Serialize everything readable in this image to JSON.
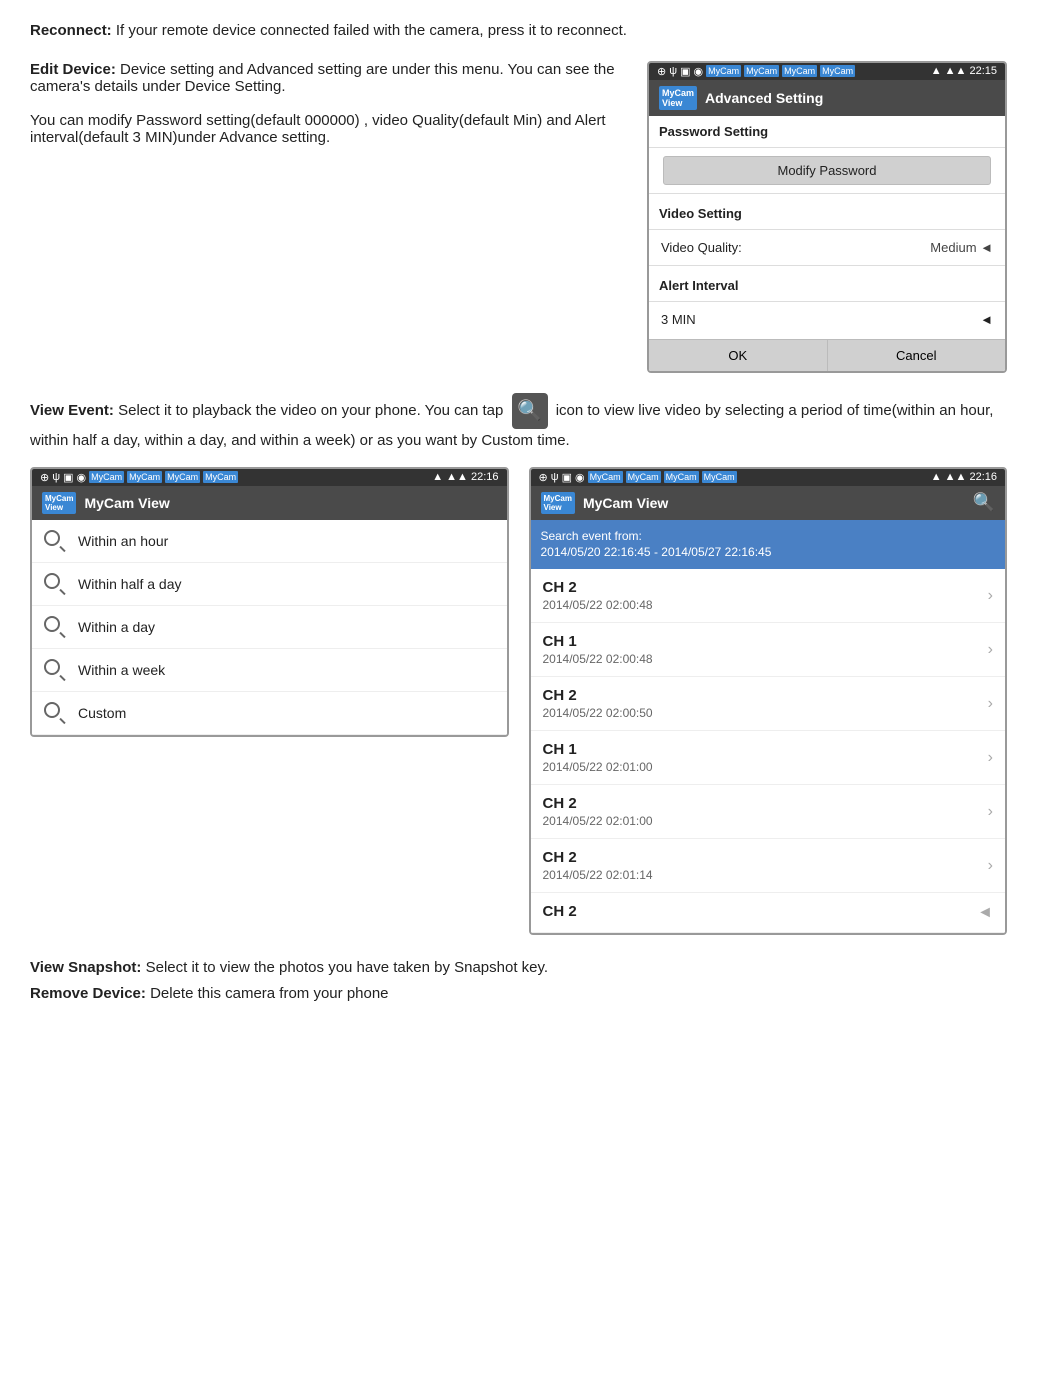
{
  "reconnect": {
    "label": "Reconnect:",
    "text": "If your remote device connected failed with the camera, press it to reconnect."
  },
  "editDevice": {
    "label": "Edit Device:",
    "para1": "Device setting and Advanced setting are under this menu. You can see the camera's details under Device Setting.",
    "para2": "You can modify Password setting(default 000000) , video Quality(default Min) and Alert interval(default 3 MIN)under Advance setting.",
    "phone": {
      "statusbar": {
        "left_icons": "⊕ ψ ▣ ◉",
        "app_icons": "MyCam MyCam MyCam MyCam",
        "right": "▲ ▲▲ 22:15"
      },
      "title": "Advanced Setting",
      "sections": [
        {
          "name": "Password Setting",
          "button": "Modify Password"
        },
        {
          "name": "Video Setting",
          "row_label": "Video Quality:",
          "row_value": "Medium"
        },
        {
          "name": "Alert Interval",
          "row_label": "3 MIN"
        }
      ],
      "ok_label": "OK",
      "cancel_label": "Cancel"
    }
  },
  "viewEvent": {
    "label": "View Event:",
    "text": "Select it to playback the video on your phone. You can tap",
    "text2": "icon to view live video by selecting a period of time(within an hour, within half a day, within a day, and within a week) or as you want by Custom time.",
    "left_phone": {
      "statusbar_right": "22:16",
      "title": "MyCam View",
      "logo": "MyCam View",
      "menu_items": [
        "Within an hour",
        "Within half a day",
        "Within a day",
        "Within a week",
        "Custom"
      ]
    },
    "right_phone": {
      "statusbar_right": "22:16",
      "title": "MyCam View",
      "search_bar": "Search event from:\n2014/05/20 22:16:45 - 2014/05/27 22:16:45",
      "events": [
        {
          "ch": "CH 2",
          "date": "2014/05/22 02:00:48"
        },
        {
          "ch": "CH 1",
          "date": "2014/05/22 02:00:48"
        },
        {
          "ch": "CH 2",
          "date": "2014/05/22 02:00:50"
        },
        {
          "ch": "CH 1",
          "date": "2014/05/22 02:01:00"
        },
        {
          "ch": "CH 2",
          "date": "2014/05/22 02:01:00"
        },
        {
          "ch": "CH 2",
          "date": "2014/05/22 02:01:14"
        },
        {
          "ch": "CH 2",
          "date": ""
        }
      ]
    }
  },
  "viewSnapshot": {
    "label": "View Snapshot:",
    "text": "Select it to view the photos you have taken by Snapshot key."
  },
  "removeDevice": {
    "label": "Remove Device:",
    "text": "Delete this camera from your phone"
  }
}
